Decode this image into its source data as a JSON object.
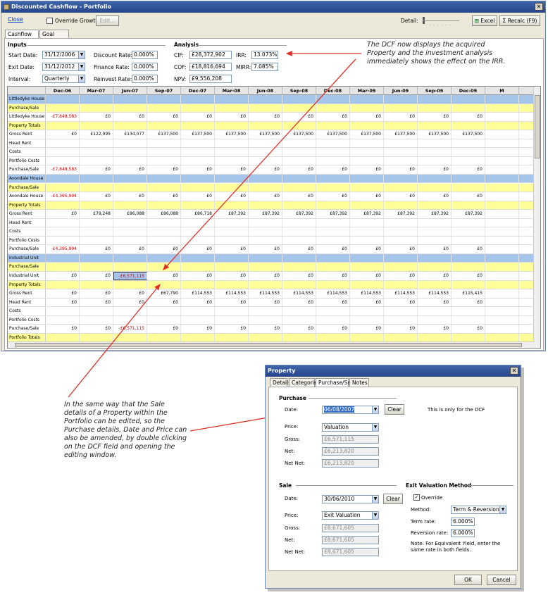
{
  "main_window": {
    "title": "Discounted Cashflow - Portfolio",
    "close_link": "Close",
    "override_growth": "Override Growth",
    "edit_button": "Edit...",
    "detail_label": "Detail:",
    "excel_button": "Excel",
    "recalc_button": "Recalc (F9)",
    "tabs": [
      "Cashflow",
      "Goal Seek"
    ],
    "inputs": {
      "section": "Inputs",
      "start_label": "Start Date:",
      "start_value": "31/12/2006",
      "exit_label": "Exit Date:",
      "exit_value": "31/12/2012",
      "interval_label": "Interval:",
      "interval_value": "Quarterly",
      "discount_label": "Discount Rate:",
      "discount_value": "0.000%",
      "finance_label": "Finance Rate:",
      "finance_value": "0.000%",
      "reinvest_label": "Reinvest Rate:",
      "reinvest_value": "0.000%"
    },
    "analysis": {
      "section": "Analysis",
      "cif_label": "CIF:",
      "cif_value": "£28,372,902",
      "cof_label": "COF:",
      "cof_value": "£18,816,694",
      "npv_label": "NPV:",
      "npv_value": "£9,556,208",
      "irr_label": "IRR:",
      "irr_value": "13.073%",
      "mirr_label": "MIRR:",
      "mirr_value": "7.085%"
    },
    "columns": [
      "Dec-06",
      "Mar-07",
      "Jun-07",
      "Sep-07",
      "Dec-07",
      "Mar-08",
      "Jun-08",
      "Sep-08",
      "Dec-08",
      "Mar-09",
      "Jun-09",
      "Sep-09",
      "Dec-09",
      "M"
    ],
    "rows": [
      {
        "name": "Littledyke House",
        "style": "group",
        "values": []
      },
      {
        "name": "Purchase/Sale",
        "style": "yellow",
        "values": []
      },
      {
        "name": "Littledyke House",
        "style": "",
        "values": [
          "-£7,849,583",
          "£0",
          "£0",
          "£0",
          "£0",
          "£0",
          "£0",
          "£0",
          "£0",
          "£0",
          "£0",
          "£0",
          "£0"
        ]
      },
      {
        "name": "Property Totals",
        "style": "yellow",
        "values": []
      },
      {
        "name": "Gross Rent",
        "style": "",
        "values": [
          "£0",
          "£122,095",
          "£134,077",
          "£137,500",
          "£137,500",
          "£137,500",
          "£137,500",
          "£137,500",
          "£137,500",
          "£137,500",
          "£137,500",
          "£137,500",
          "£137,500"
        ]
      },
      {
        "name": "Head Rent",
        "style": "",
        "values": []
      },
      {
        "name": "Costs",
        "style": "",
        "values": []
      },
      {
        "name": "Portfolio Costs",
        "style": "",
        "values": []
      },
      {
        "name": "Purchase/Sale",
        "style": "",
        "values": [
          "-£7,849,583",
          "£0",
          "£0",
          "£0",
          "£0",
          "£0",
          "£0",
          "£0",
          "£0",
          "£0",
          "£0",
          "£0",
          "£0"
        ]
      },
      {
        "name": "Avondale House",
        "style": "group",
        "values": []
      },
      {
        "name": "Purchase/Sale",
        "style": "yellow",
        "values": []
      },
      {
        "name": "Avondale House",
        "style": "",
        "values": [
          "-£4,395,994",
          "£0",
          "£0",
          "£0",
          "£0",
          "£0",
          "£0",
          "£0",
          "£0",
          "£0",
          "£0",
          "£0",
          "£0"
        ]
      },
      {
        "name": "Property Totals",
        "style": "yellow",
        "values": []
      },
      {
        "name": "Gross Rent",
        "style": "",
        "values": [
          "£0",
          "£79,248",
          "£86,088",
          "£86,088",
          "£86,718",
          "£87,392",
          "£87,392",
          "£87,392",
          "£87,392",
          "£87,392",
          "£87,392",
          "£87,392",
          "£87,392"
        ]
      },
      {
        "name": "Head Rent",
        "style": "",
        "values": []
      },
      {
        "name": "Costs",
        "style": "",
        "values": []
      },
      {
        "name": "Portfolio Costs",
        "style": "",
        "values": []
      },
      {
        "name": "Purchase/Sale",
        "style": "",
        "values": [
          "-£4,395,994",
          "£0",
          "£0",
          "£0",
          "£0",
          "£0",
          "£0",
          "£0",
          "£0",
          "£0",
          "£0",
          "£0",
          "£0"
        ]
      },
      {
        "name": "Industrial Unit",
        "style": "group",
        "values": []
      },
      {
        "name": "Purchase/Sale",
        "style": "yellow",
        "values": []
      },
      {
        "name": "Industrial Unit",
        "style": "",
        "values": [
          "£0",
          "£0",
          "-£6,571,115",
          "£0",
          "£0",
          "£0",
          "£0",
          "£0",
          "£0",
          "£0",
          "£0",
          "£0",
          "£0"
        ]
      },
      {
        "name": "Property Totals",
        "style": "yellow",
        "values": []
      },
      {
        "name": "Gross Rent",
        "style": "",
        "values": [
          "£0",
          "£0",
          "£0",
          "£67,790",
          "£114,553",
          "£114,553",
          "£114,553",
          "£114,553",
          "£114,553",
          "£114,553",
          "£114,553",
          "£114,553",
          "£115,415"
        ]
      },
      {
        "name": "Head Rent",
        "style": "",
        "values": [
          "£0",
          "£0",
          "£0",
          "£0",
          "£0",
          "£0",
          "£0",
          "£0",
          "£0",
          "£0",
          "£0",
          "£0",
          "£0"
        ]
      },
      {
        "name": "Costs",
        "style": "",
        "values": []
      },
      {
        "name": "Portfolio Costs",
        "style": "",
        "values": []
      },
      {
        "name": "Purchase/Sale",
        "style": "",
        "values": [
          "£0",
          "£0",
          "-£6,571,115",
          "£0",
          "£0",
          "£0",
          "£0",
          "£0",
          "£0",
          "£0",
          "£0",
          "£0",
          "£0"
        ]
      },
      {
        "name": "Portfolio Totals",
        "style": "yellow",
        "values": []
      }
    ]
  },
  "callout_top": "The DCF now displays the acquired Property and the investment analysis immediately shows the effect on the IRR.",
  "callout_bottom": "In the same way that the Sale details of a Property within the Portfolio can be edited, so the Purchase details, Date and Price can also be amended, by double clicking on the DCF field and opening the editing window.",
  "dialog": {
    "title": "Property",
    "tabs": [
      "Details",
      "Categories",
      "Purchase/Sale",
      "Notes"
    ],
    "purchase": {
      "section": "Purchase",
      "date_label": "Date:",
      "date_value": "06/08/2007",
      "clear": "Clear",
      "note": "This is only for the DCF",
      "price_label": "Price:",
      "price_value": "Valuation",
      "gross_label": "Gross:",
      "gross_value": "£6,571,115",
      "net_label": "Net:",
      "net_value": "£6,213,820",
      "netnet_label": "Net Net:",
      "netnet_value": "£6,213,820"
    },
    "sale": {
      "section": "Sale",
      "date_label": "Date:",
      "date_value": "30/06/2010",
      "clear": "Clear",
      "price_label": "Price:",
      "price_value": "Exit Valuation",
      "gross_label": "Gross:",
      "gross_value": "£8,671,605",
      "net_label": "Net:",
      "net_value": "£8,671,605",
      "netnet_label": "Net Net:",
      "netnet_value": "£8,671,605"
    },
    "exit": {
      "section": "Exit Valuation Method",
      "override": "Override",
      "method_label": "Method:",
      "method_value": "Term & Reversion",
      "term_label": "Term rate:",
      "term_value": "6.000%",
      "rev_label": "Reversion rate:",
      "rev_value": "6.000%",
      "note": "Note: For Equivalent Yield, enter the same rate in both fields."
    },
    "ok": "OK",
    "cancel": "Cancel"
  }
}
